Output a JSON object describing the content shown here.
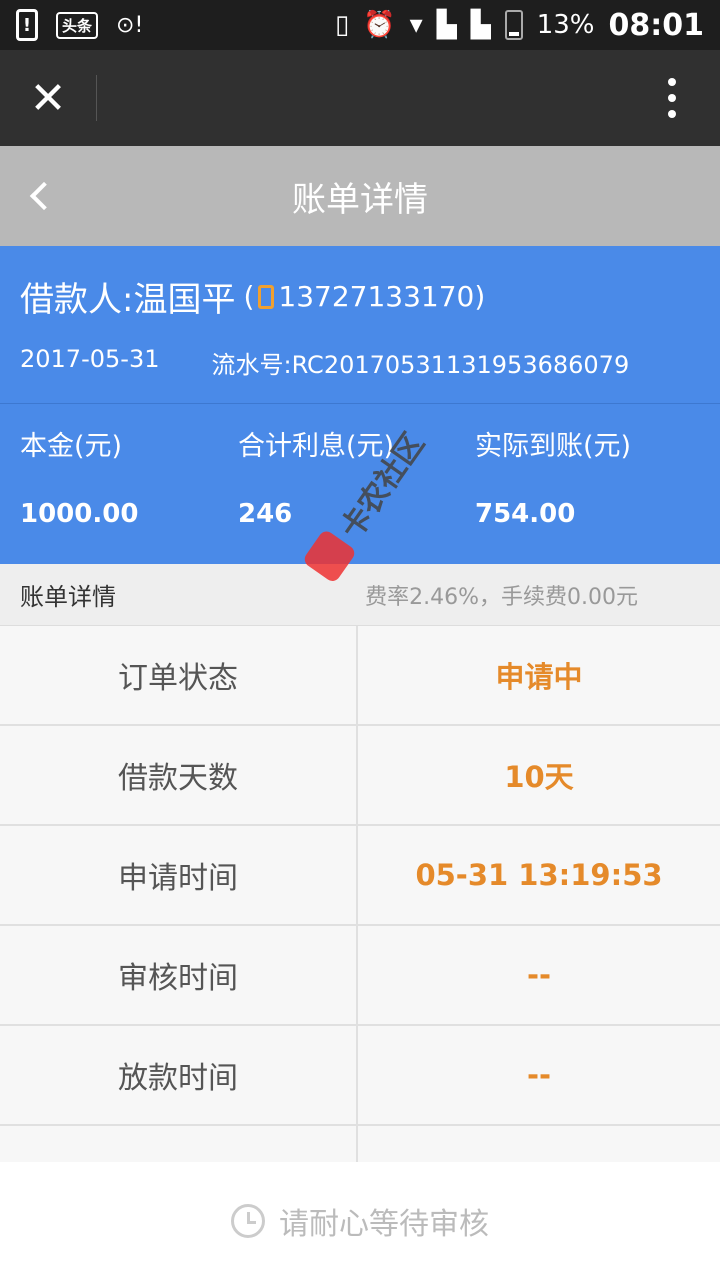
{
  "status_bar": {
    "app_badge": "头条",
    "battery": "13%",
    "time": "08:01"
  },
  "header": {
    "title": "账单详情"
  },
  "info": {
    "borrower_label": "借款人:温国平",
    "phone": "13727133170",
    "date": "2017-05-31",
    "serial_label": "流水号:",
    "serial": "RC20170531131953686079",
    "principal_label": "本金(元)",
    "principal": "1000.00",
    "interest_label": "合计利息(元)",
    "interest": "246",
    "actual_label": "实际到账(元)",
    "actual": "754.00"
  },
  "details": {
    "title": "账单详情",
    "note": "费率2.46%，手续费0.00元",
    "rows": [
      {
        "label": "订单状态",
        "value": "申请中"
      },
      {
        "label": "借款天数",
        "value": "10天"
      },
      {
        "label": "申请时间",
        "value": "05-31 13:19:53"
      },
      {
        "label": "审核时间",
        "value": "--"
      },
      {
        "label": "放款时间",
        "value": "--"
      }
    ]
  },
  "footer": {
    "text": "请耐心等待审核"
  },
  "watermark": {
    "text": "卡农社区"
  }
}
